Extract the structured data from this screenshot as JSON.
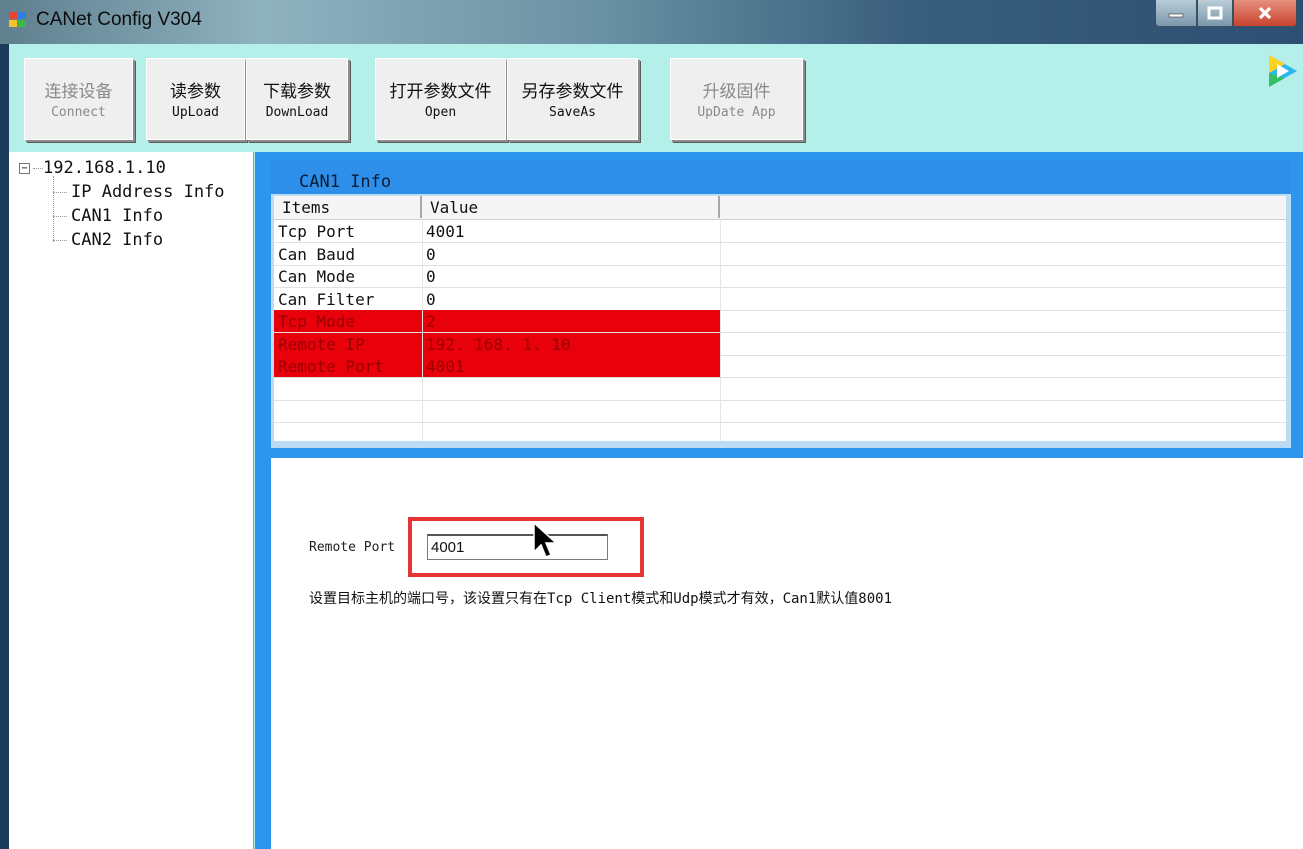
{
  "window": {
    "title": "CANet Config V304"
  },
  "toolbar": [
    {
      "cn": "连接设备",
      "en": "Connect",
      "enabled": false
    },
    {
      "cn": "读参数",
      "en": "UpLoad",
      "enabled": true
    },
    {
      "cn": "下载参数",
      "en": "DownLoad",
      "enabled": true
    },
    {
      "cn": "打开参数文件",
      "en": "Open",
      "enabled": true
    },
    {
      "cn": "另存参数文件",
      "en": "SaveAs",
      "enabled": true
    },
    {
      "cn": "升级固件",
      "en": "UpDate App",
      "enabled": false
    }
  ],
  "tree": {
    "root": "192.168.1.10",
    "root_expander": "−",
    "children": [
      "IP Address Info",
      "CAN1 Info",
      "CAN2 Info"
    ]
  },
  "info": {
    "title": "CAN1 Info",
    "columns": [
      "Items",
      "Value"
    ],
    "rows": [
      {
        "name": "Tcp Port",
        "value": "4001",
        "error": false
      },
      {
        "name": "Can Baud",
        "value": "0",
        "error": false
      },
      {
        "name": "Can Mode",
        "value": "0",
        "error": false
      },
      {
        "name": "Can Filter",
        "value": "0",
        "error": false
      },
      {
        "name": "Tcp Mode",
        "value": "2",
        "error": true
      },
      {
        "name": "Remote IP",
        "value": " 192. 168. 1. 10",
        "error": true
      },
      {
        "name": "Remote Port",
        "value": "4001",
        "error": true
      }
    ]
  },
  "editor": {
    "label": "Remote Port",
    "value": "4001",
    "description": "设置目标主机的端口号，该设置只有在Tcp Client模式和Udp模式才有效，Can1默认值8001"
  },
  "colors": {
    "error_row": "#e8000a",
    "panel_blue": "#2e95ef",
    "client_bg": "#b4efea",
    "highlight": "#e63434"
  }
}
